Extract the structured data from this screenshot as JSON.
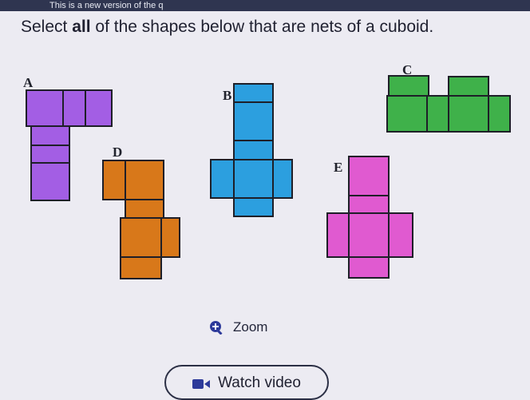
{
  "banner": {
    "text": "This is a new version of the q"
  },
  "question": {
    "prefix": "Select ",
    "bold": "all",
    "suffix": " of the shapes below that are nets of a cuboid."
  },
  "shapes": [
    {
      "label": "A",
      "color": "#a35ee4"
    },
    {
      "label": "B",
      "color": "#2c9fdf"
    },
    {
      "label": "C",
      "color": "#3fb14a"
    },
    {
      "label": "D",
      "color": "#d8781a"
    },
    {
      "label": "E",
      "color": "#e05ad0"
    }
  ],
  "zoom": {
    "label": "Zoom",
    "icon": "zoom-in-icon"
  },
  "watch_video": {
    "label": "Watch video",
    "icon": "video-icon"
  }
}
